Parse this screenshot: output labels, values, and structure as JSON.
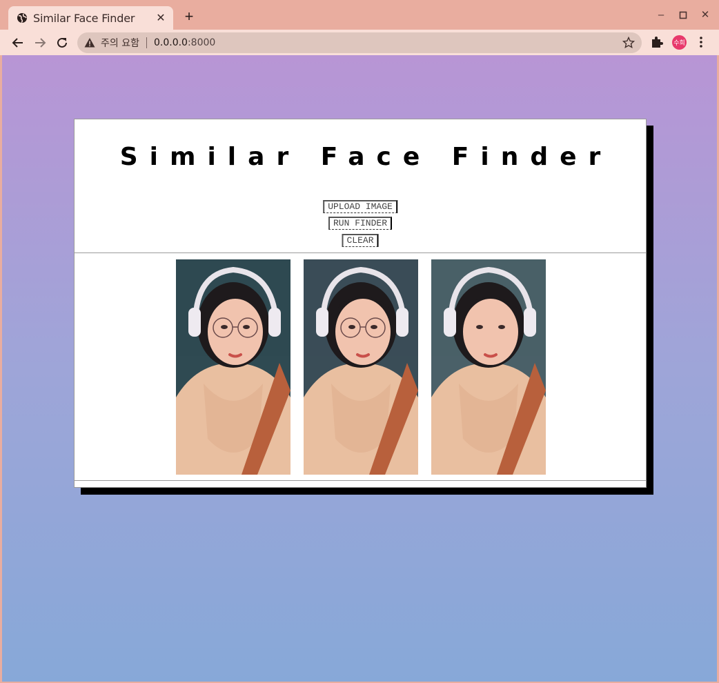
{
  "browser": {
    "tab_title": "Similar Face Finder",
    "tab_close": "✕",
    "new_tab": "+",
    "security_warning": "주의 요함",
    "url_host": "0.0.0.0",
    "url_port": ":8000",
    "profile_initials": "수희"
  },
  "page": {
    "title": "Similar Face Finder",
    "buttons": {
      "upload": "UPLOAD IMAGE",
      "run": "RUN FINDER",
      "clear": "CLEAR"
    },
    "results": [
      {
        "name": "result-photo-1",
        "tone": "#2f4a52",
        "glasses": true
      },
      {
        "name": "result-photo-2",
        "tone": "#3a4d57",
        "glasses": true
      },
      {
        "name": "result-photo-3",
        "tone": "#4a6068",
        "glasses": false
      }
    ]
  },
  "colors": {
    "gradient_top": "#b895d5",
    "gradient_bottom": "#87a8d8",
    "chrome": "#e9ad9f",
    "chrome_tab": "#f9dfd8",
    "avatar": "#e8386b"
  }
}
